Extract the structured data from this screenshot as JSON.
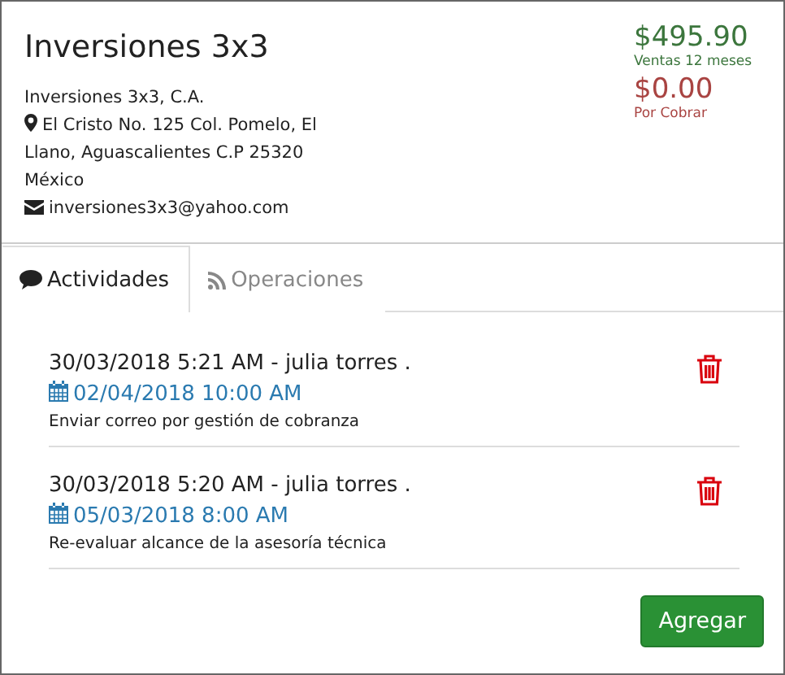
{
  "company": {
    "name": "Inversiones 3x3",
    "legal_name": "Inversiones 3x3, C.A.",
    "address_lines": [
      "El Cristo No. 125 Col. Pomelo, El",
      "Llano, Aguascalientes C.P 25320",
      "México"
    ],
    "email": "inversiones3x3@yahoo.com"
  },
  "totals": [
    {
      "amount": "$495.90",
      "label": "Ventas 12 meses",
      "color": "#3c763d"
    },
    {
      "amount": "$0.00",
      "label": "Por Cobrar",
      "color": "#a94442"
    }
  ],
  "tabs": [
    {
      "label": "Actividades",
      "selected": true
    },
    {
      "label": "Operaciones",
      "selected": false
    }
  ],
  "activities": [
    {
      "created": "30/03/2018 5:21 AM - julia torres .",
      "due": "02/04/2018 10:00 AM",
      "description": "Enviar correo por gestión de cobranza"
    },
    {
      "created": "30/03/2018 5:20 AM - julia torres .",
      "due": "05/03/2018 8:00 AM",
      "description": "Re-evaluar alcance de la asesoría técnica"
    }
  ],
  "add_button": "Agregar"
}
